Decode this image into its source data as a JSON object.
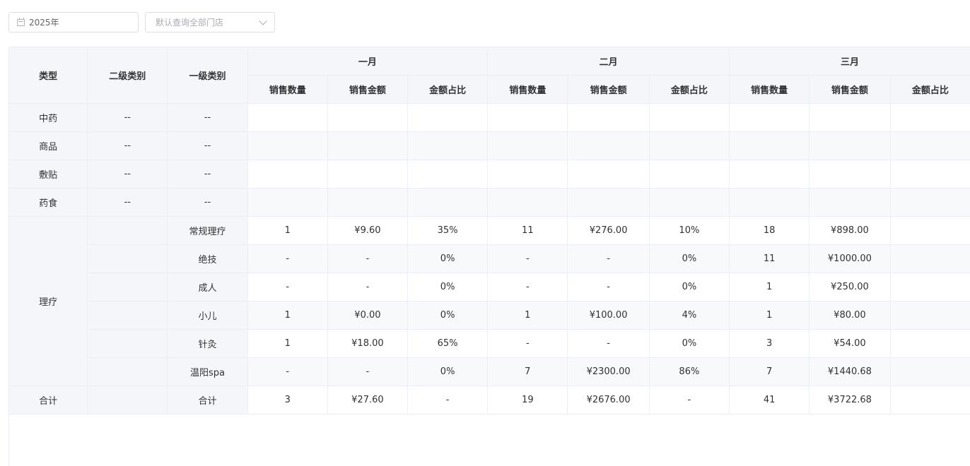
{
  "filters": {
    "year": "2025年",
    "store_placeholder": "默认查询全部门店"
  },
  "table": {
    "headers": {
      "type": "类型",
      "level2": "二级类别",
      "level1": "一级类别",
      "months": [
        "一月",
        "二月",
        "三月"
      ],
      "subcols": [
        "销售数量",
        "销售金额",
        "金额占比"
      ]
    },
    "empty_rows": [
      {
        "type": "中药",
        "level2": "--",
        "level1": "--"
      },
      {
        "type": "商品",
        "level2": "--",
        "level1": "--"
      },
      {
        "type": "敷贴",
        "level2": "--",
        "level1": "--"
      },
      {
        "type": "药食",
        "level2": "--",
        "level1": "--"
      }
    ],
    "group_type": "理疗",
    "group_rows": [
      {
        "level1": "常规理疗",
        "cells": [
          "1",
          "¥9.60",
          "35%",
          "11",
          "¥276.00",
          "10%",
          "18",
          "¥898.00"
        ]
      },
      {
        "level1": "绝技",
        "cells": [
          "-",
          "-",
          "0%",
          "-",
          "-",
          "0%",
          "11",
          "¥1000.00"
        ]
      },
      {
        "level1": "成人",
        "cells": [
          "-",
          "-",
          "0%",
          "-",
          "-",
          "0%",
          "1",
          "¥250.00"
        ]
      },
      {
        "level1": "小儿",
        "cells": [
          "1",
          "¥0.00",
          "0%",
          "1",
          "¥100.00",
          "4%",
          "1",
          "¥80.00"
        ]
      },
      {
        "level1": "针灸",
        "cells": [
          "1",
          "¥18.00",
          "65%",
          "-",
          "-",
          "0%",
          "3",
          "¥54.00"
        ]
      },
      {
        "level1": "温阳spa",
        "cells": [
          "-",
          "-",
          "0%",
          "7",
          "¥2300.00",
          "86%",
          "7",
          "¥1440.68"
        ]
      }
    ],
    "total": {
      "type": "合计",
      "level1": "合计",
      "cells": [
        "3",
        "¥27.60",
        "-",
        "19",
        "¥2676.00",
        "-",
        "41",
        "¥3722.68"
      ]
    }
  }
}
